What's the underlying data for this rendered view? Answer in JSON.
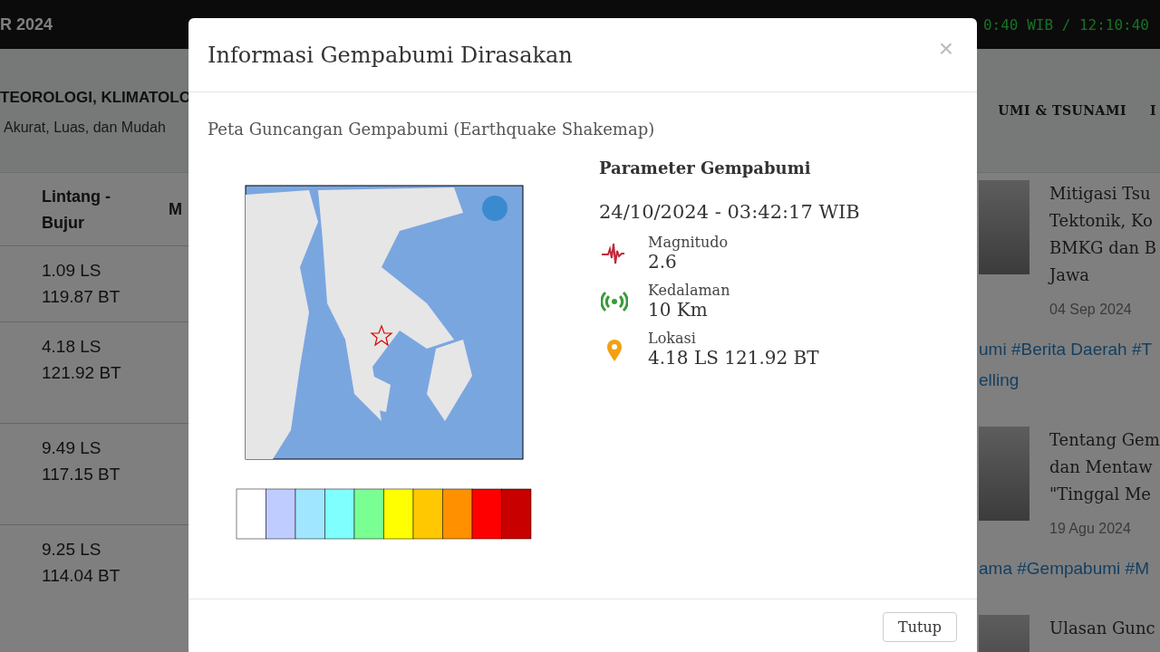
{
  "top_bar": {
    "date_fragment": "R 2024",
    "clock": "0:40 WIB / 12:10:40"
  },
  "header": {
    "title_fragment": "TEOROLOGI, KLIMATOLO",
    "tagline_fragment": "Akurat, Luas, dan Mudah",
    "nav": [
      "UMI & TSUNAMI",
      "I"
    ]
  },
  "table": {
    "columns": [
      "Lintang - Bujur",
      "M"
    ],
    "rows": [
      {
        "lat": "1.09 LS",
        "lon": "119.87 BT"
      },
      {
        "lat": "4.18 LS",
        "lon": "121.92 BT"
      },
      {
        "lat": "9.49 LS",
        "lon": "117.15 BT"
      },
      {
        "lat": "9.25 LS",
        "lon": "114.04 BT"
      }
    ]
  },
  "news": [
    {
      "title_lines": [
        "Mitigasi Tsu",
        "Tektonik, Ko",
        "BMKG dan B",
        "Jawa"
      ],
      "date": "04 Sep 2024",
      "tags": [
        "umi #Berita Daerah #T",
        "elling"
      ]
    },
    {
      "title_lines": [
        "Tentang Gem",
        "dan Mentaw",
        "\"Tinggal Me"
      ],
      "date": "19 Agu 2024",
      "tags": [
        "ama #Gempabumi #M"
      ]
    },
    {
      "title_lines": [
        "Ulasan Gunc"
      ]
    }
  ],
  "modal": {
    "title": "Informasi Gempabumi Dirasakan",
    "close": "×",
    "section_title": "Peta Guncangan Gempabumi (Earthquake Shakemap)",
    "parameters_title": "Parameter Gempabumi",
    "datetime": "24/10/2024 - 03:42:17 WIB",
    "parameters": [
      {
        "kind": "magnitude",
        "label": "Magnitudo",
        "value": "2.6"
      },
      {
        "kind": "depth",
        "label": "Kedalaman",
        "value": "10 Km"
      },
      {
        "kind": "location",
        "label": "Lokasi",
        "value": "4.18 LS 121.92 BT"
      }
    ],
    "button": "Tutup"
  }
}
